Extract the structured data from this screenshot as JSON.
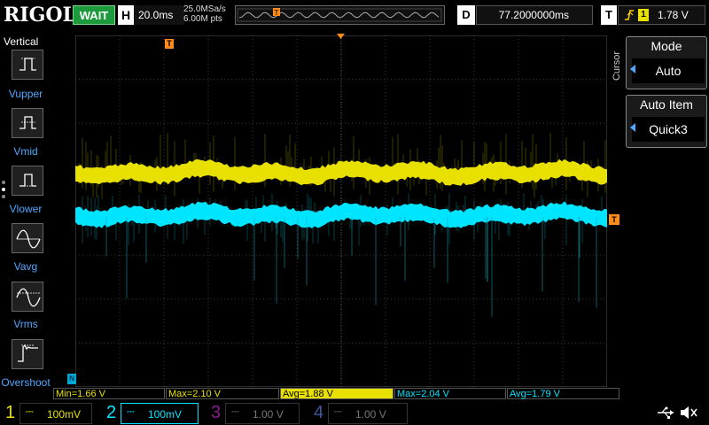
{
  "header": {
    "logo": "RIGOL",
    "run_status": "WAIT",
    "timebase_label": "H",
    "timebase": "20.0ms",
    "sample_rate": "25.0MSa/s",
    "memory_depth": "6.00M pts",
    "delay_label": "D",
    "delay": "77.2000000ms",
    "trigger_label": "T",
    "trigger_source": "1",
    "trigger_level": "1.78 V"
  },
  "left_panel": {
    "title": "Vertical",
    "tools": [
      {
        "label": "Vupper",
        "icon": "vupper-icon"
      },
      {
        "label": "Vmid",
        "icon": "vmid-icon"
      },
      {
        "label": "Vlower",
        "icon": "vlower-icon"
      },
      {
        "label": "Vavg",
        "icon": "vavg-icon"
      },
      {
        "label": "Vrms",
        "icon": "vrms-icon"
      },
      {
        "label": "Overshoot",
        "icon": "overshoot-icon"
      }
    ]
  },
  "right_panel": {
    "section": "Cursor",
    "menus": [
      {
        "title": "Mode",
        "value": "Auto"
      },
      {
        "title": "Auto Item",
        "value": "Quick3"
      }
    ]
  },
  "measurements": [
    {
      "text": "Min=1.66 V",
      "color": "#e8e000"
    },
    {
      "text": "Max=2.10 V",
      "color": "#e8e000"
    },
    {
      "text": "Avg=1.88 V",
      "color": "#000000",
      "bg": "#e8e000"
    },
    {
      "text": "Max=2.04 V",
      "color": "#00e5ff"
    },
    {
      "text": "Avg=1.79 V",
      "color": "#00e5ff"
    }
  ],
  "channels": [
    {
      "num": "1",
      "scale": "100mV",
      "color": "#e8e000"
    },
    {
      "num": "2",
      "scale": "100mV",
      "color": "#00e5ff"
    },
    {
      "num": "3",
      "scale": "1.00 V",
      "color": "#8a1a8a"
    },
    {
      "num": "4",
      "scale": "1.00 V",
      "color": "#3a5a9a"
    }
  ],
  "markers": {
    "trigger_pos": "T",
    "trigger_level": "T",
    "channel_offset": "N"
  },
  "colors": {
    "ch1": "#e8e000",
    "ch2": "#00e5ff",
    "grid": "#3a3a3a",
    "marker_orange": "#ff8c1a"
  }
}
